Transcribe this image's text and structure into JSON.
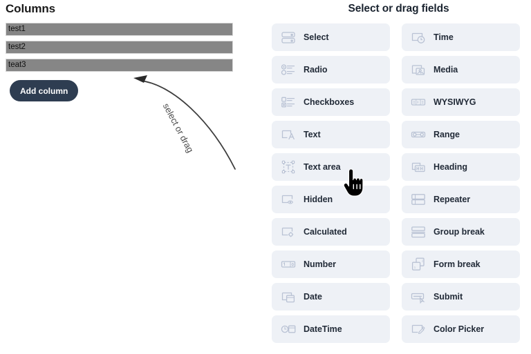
{
  "columns_panel": {
    "title": "Columns",
    "rows": [
      {
        "label": "test1"
      },
      {
        "label": "test2"
      },
      {
        "label": "teat3"
      }
    ],
    "add_button_label": "Add column"
  },
  "annotation": {
    "label": "select or drag",
    "arrow_icon": "curved-arrow-icon"
  },
  "fields_panel": {
    "title": "Select or drag fields",
    "cards": [
      {
        "label": "Select",
        "icon": "select-icon"
      },
      {
        "label": "Time",
        "icon": "time-icon"
      },
      {
        "label": "Radio",
        "icon": "radio-icon"
      },
      {
        "label": "Media",
        "icon": "media-icon"
      },
      {
        "label": "Checkboxes",
        "icon": "checkboxes-icon"
      },
      {
        "label": "WYSIWYG",
        "icon": "wysiwyg-icon"
      },
      {
        "label": "Text",
        "icon": "text-icon"
      },
      {
        "label": "Range",
        "icon": "range-icon"
      },
      {
        "label": "Text area",
        "icon": "text-area-icon"
      },
      {
        "label": "Heading",
        "icon": "heading-icon"
      },
      {
        "label": "Hidden",
        "icon": "hidden-icon"
      },
      {
        "label": "Repeater",
        "icon": "repeater-icon"
      },
      {
        "label": "Calculated",
        "icon": "calculated-icon"
      },
      {
        "label": "Group break",
        "icon": "group-break-icon"
      },
      {
        "label": "Number",
        "icon": "number-icon"
      },
      {
        "label": "Form break",
        "icon": "form-break-icon"
      },
      {
        "label": "Date",
        "icon": "date-icon"
      },
      {
        "label": "Submit",
        "icon": "submit-icon"
      },
      {
        "label": "DateTime",
        "icon": "datetime-icon"
      },
      {
        "label": "Color Picker",
        "icon": "color-picker-icon"
      }
    ]
  },
  "cursor": {
    "icon": "pointing-hand-cursor"
  },
  "colors": {
    "card_background": "#eef1f6",
    "card_icon": "#b9c2d4",
    "card_label": "#222b38",
    "column_row": "#868686",
    "add_button": "#2e3d51",
    "page_background": "#ffffff",
    "annotation": "#4a4a4a"
  }
}
